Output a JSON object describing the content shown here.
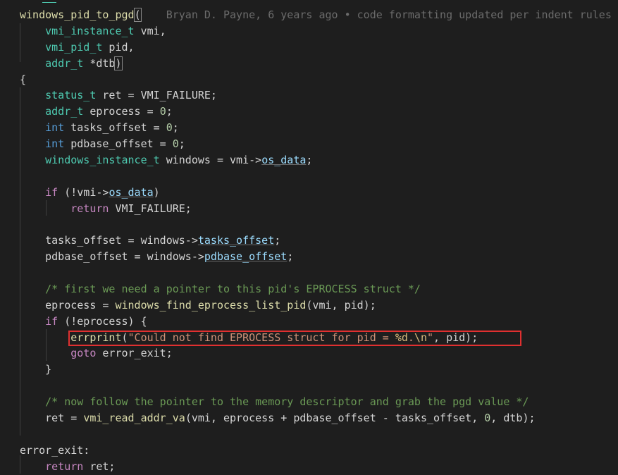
{
  "editor": {
    "lines": [
      [
        {
          "t": "windows_pid_to_pgd",
          "c": "fn"
        },
        {
          "t": "(",
          "c": "br"
        },
        {
          "t": "    Bryan D. Payne, 6 years ago • code formatting updated per indent rules",
          "c": "blame"
        }
      ],
      [
        {
          "t": "    "
        },
        {
          "t": "vmi_instance_t",
          "c": "ty"
        },
        {
          "t": " vmi,",
          "c": "pl"
        }
      ],
      [
        {
          "t": "    "
        },
        {
          "t": "vmi_pid_t",
          "c": "ty"
        },
        {
          "t": " pid,",
          "c": "pl"
        }
      ],
      [
        {
          "t": "    "
        },
        {
          "t": "addr_t",
          "c": "ty"
        },
        {
          "t": " *dtb",
          "c": "pl"
        },
        {
          "t": ")",
          "c": "br"
        }
      ],
      [
        {
          "t": "{",
          "c": "pl"
        }
      ],
      [
        {
          "t": "    "
        },
        {
          "t": "status_t",
          "c": "ty"
        },
        {
          "t": " ret = VMI_FAILURE;",
          "c": "pl"
        }
      ],
      [
        {
          "t": "    "
        },
        {
          "t": "addr_t",
          "c": "ty"
        },
        {
          "t": " eprocess = ",
          "c": "pl"
        },
        {
          "t": "0",
          "c": "num"
        },
        {
          "t": ";",
          "c": "pl"
        }
      ],
      [
        {
          "t": "    "
        },
        {
          "t": "int",
          "c": "kw"
        },
        {
          "t": " tasks_offset = ",
          "c": "pl"
        },
        {
          "t": "0",
          "c": "num"
        },
        {
          "t": ";",
          "c": "pl"
        }
      ],
      [
        {
          "t": "    "
        },
        {
          "t": "int",
          "c": "kw"
        },
        {
          "t": " pdbase_offset = ",
          "c": "pl"
        },
        {
          "t": "0",
          "c": "num"
        },
        {
          "t": ";",
          "c": "pl"
        }
      ],
      [
        {
          "t": "    "
        },
        {
          "t": "windows_instance_t",
          "c": "ty"
        },
        {
          "t": " windows = vmi->",
          "c": "pl"
        },
        {
          "t": "os_data",
          "c": "var",
          "u": true
        },
        {
          "t": ";",
          "c": "pl"
        }
      ],
      [],
      [
        {
          "t": "    "
        },
        {
          "t": "if",
          "c": "ctl"
        },
        {
          "t": " (!vmi->",
          "c": "pl"
        },
        {
          "t": "os_data",
          "c": "var",
          "u": true
        },
        {
          "t": ")",
          "c": "pl"
        }
      ],
      [
        {
          "t": "        "
        },
        {
          "t": "return",
          "c": "ctl"
        },
        {
          "t": " VMI_FAILURE;",
          "c": "pl"
        }
      ],
      [],
      [
        {
          "t": "    "
        },
        {
          "t": "tasks_offset = windows->",
          "c": "pl"
        },
        {
          "t": "tasks_offset",
          "c": "var",
          "u": true
        },
        {
          "t": ";",
          "c": "pl"
        }
      ],
      [
        {
          "t": "    "
        },
        {
          "t": "pdbase_offset = windows->",
          "c": "pl"
        },
        {
          "t": "pdbase_offset",
          "c": "var",
          "u": true
        },
        {
          "t": ";",
          "c": "pl"
        }
      ],
      [],
      [
        {
          "t": "    "
        },
        {
          "t": "/* first we need a pointer to this pid's EPROCESS struct */",
          "c": "cm"
        }
      ],
      [
        {
          "t": "    "
        },
        {
          "t": "eprocess = ",
          "c": "pl"
        },
        {
          "t": "windows_find_eprocess_list_pid",
          "c": "fn"
        },
        {
          "t": "(vmi, pid);",
          "c": "pl"
        }
      ],
      [
        {
          "t": "    "
        },
        {
          "t": "if",
          "c": "ctl"
        },
        {
          "t": " (!eprocess) {",
          "c": "pl"
        }
      ],
      [
        {
          "t": "        "
        },
        {
          "t": "errprint",
          "c": "fn"
        },
        {
          "t": "(",
          "c": "pl"
        },
        {
          "t": "\"Could not find EPROCESS struct for pid = ",
          "c": "str"
        },
        {
          "t": "%d",
          "c": "esc"
        },
        {
          "t": ".",
          "c": "str"
        },
        {
          "t": "\\n",
          "c": "esc"
        },
        {
          "t": "\"",
          "c": "str"
        },
        {
          "t": ", pid);",
          "c": "pl"
        }
      ],
      [
        {
          "t": "        "
        },
        {
          "t": "goto",
          "c": "ctl"
        },
        {
          "t": " error_exit;",
          "c": "pl"
        }
      ],
      [
        {
          "t": "    "
        },
        {
          "t": "}",
          "c": "pl"
        }
      ],
      [],
      [
        {
          "t": "    "
        },
        {
          "t": "/* now follow the pointer to the memory descriptor and grab the pgd value */",
          "c": "cm"
        }
      ],
      [
        {
          "t": "    "
        },
        {
          "t": "ret = ",
          "c": "pl"
        },
        {
          "t": "vmi_read_addr_va",
          "c": "fn"
        },
        {
          "t": "(vmi, eprocess + pdbase_offset - tasks_offset, ",
          "c": "pl"
        },
        {
          "t": "0",
          "c": "num"
        },
        {
          "t": ", dtb);",
          "c": "pl"
        }
      ],
      [],
      [
        {
          "t": "error_exit:",
          "c": "pl"
        }
      ],
      [
        {
          "t": "    "
        },
        {
          "t": "return",
          "c": "ctl"
        },
        {
          "t": " ret;",
          "c": "pl"
        }
      ]
    ]
  },
  "colors": {
    "background": "#1e1e1e",
    "function": "#dcdcaa",
    "type": "#4ec9b0",
    "keyword": "#569cd6",
    "control": "#c586c0",
    "variable": "#9cdcfe",
    "string": "#ce9178",
    "comment": "#6a9955",
    "number": "#b5cea8",
    "highlight_box": "#e03030"
  }
}
